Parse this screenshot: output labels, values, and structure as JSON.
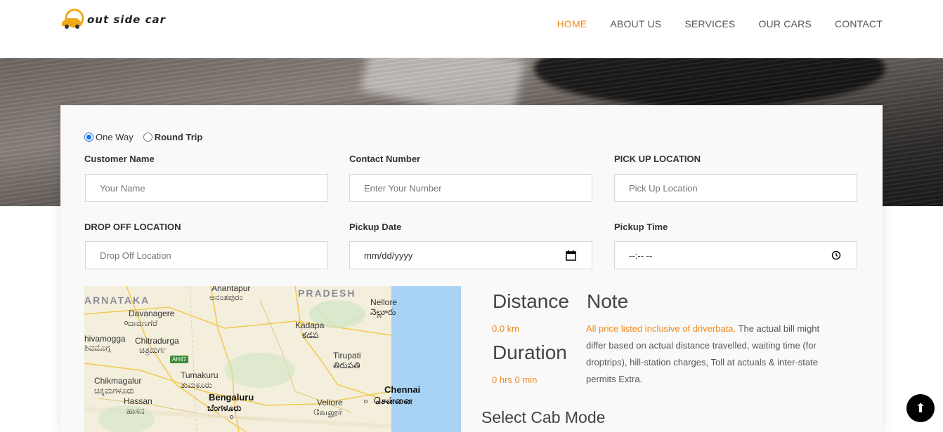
{
  "brand": {
    "name": "out side car"
  },
  "nav": {
    "items": [
      {
        "label": "HOME",
        "active": true
      },
      {
        "label": "ABOUT US"
      },
      {
        "label": "SERVICES"
      },
      {
        "label": "OUR CARS"
      },
      {
        "label": "CONTACT"
      }
    ]
  },
  "trip": {
    "one_way": "One Way",
    "round_trip": "Round Trip",
    "selected": "one_way"
  },
  "form": {
    "customer_name": {
      "label": "Customer Name",
      "placeholder": "Your Name"
    },
    "contact_number": {
      "label": "Contact Number",
      "placeholder": "Enter Your Number"
    },
    "pickup_location": {
      "label": "PICK UP LOCATION",
      "placeholder": "Pick Up Location"
    },
    "drop_location": {
      "label": "DROP OFF LOCATION",
      "placeholder": "Drop Off Location"
    },
    "pickup_date": {
      "label": "Pickup Date",
      "value": "mm/dd/yyyy"
    },
    "pickup_time": {
      "label": "Pickup Time",
      "value": "--:-- --"
    }
  },
  "map": {
    "labels": {
      "karnataka": "ARNATAKA",
      "pradesh": "PRADESH",
      "anantapur": "Anantapur",
      "anantapur_local": "ಅನಂತಪುರಂ",
      "davanagere": "Davanagere",
      "davanagere_local": "ದಾವಣಗೆರೆ",
      "nellore": "Nellore",
      "nellore_local": "నెల్లూరు",
      "kadapa": "Kadapa",
      "kadapa_local": "కడప",
      "shivamogga": "hivamogga",
      "shivamogga_local": "ಶಿವಮೊಗ್ಗ",
      "chitradurga": "Chitradurga",
      "chitradurga_local": "ಚಿತ್ರದುರ್ಗ",
      "highway": "AH47",
      "tirupati": "Tirupati",
      "tirupati_local": "తిరుపతి",
      "tumakuru": "Tumakuru",
      "tumakuru_local": "ತುಮಕೂರು",
      "chikmagalur": "Chikmagalur",
      "chikmagalur_local": "ಚಿಕ್ಕಮಗಳೂರು",
      "chennai": "Chennai",
      "chennai_local": "சென்னை",
      "hassan": "Hassan",
      "hassan_local": "ಹಾಸನ",
      "bengaluru": "Bengaluru",
      "bengaluru_local": "ಬೆಂಗಳೂರು",
      "vellore": "Vellore",
      "vellore_local": "வேலூர்"
    }
  },
  "trip_info": {
    "distance_heading": "Distance",
    "distance_value": "0.0 km",
    "duration_heading": "Duration",
    "duration_value": "0 hrs 0 min",
    "note_heading": "Note",
    "note_highlight": "All price listed inclusive of driverbata.",
    "note_text": " The actual bill might differ based on actual distance travelled, waiting time (for droptrips), hill-station charges, Toll at actuals & inter-state permits Extra.",
    "select_cab": "Select Cab Mode"
  },
  "scroll_top": {
    "icon": "arrow-up-icon",
    "glyph": "⬆"
  },
  "colors": {
    "accent": "#f08a1c",
    "text": "#333333",
    "radio": "#1a73e8"
  }
}
